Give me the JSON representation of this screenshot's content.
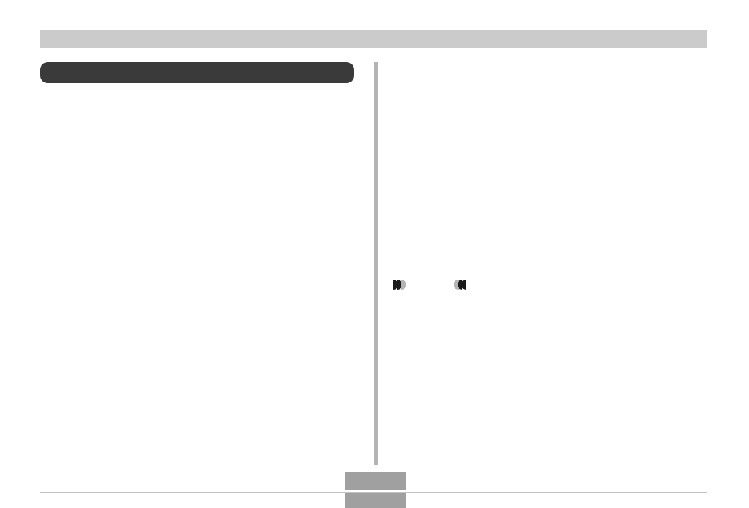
{
  "header": {
    "title": ""
  },
  "left": {
    "box_label": ""
  },
  "media": {
    "forward_icon": "forward-icon",
    "back_icon": "back-icon"
  },
  "footer": {
    "block1": "",
    "block2": ""
  }
}
